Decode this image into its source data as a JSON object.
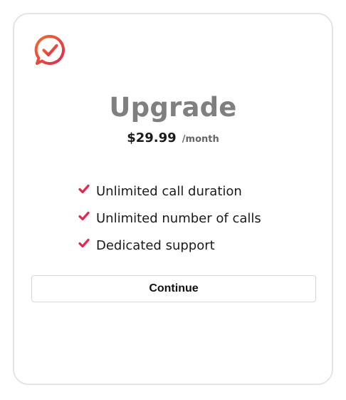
{
  "card": {
    "title": "Upgrade",
    "price": "$29.99",
    "period": "/month",
    "features": [
      {
        "label": "Unlimited call duration",
        "icon": "check-icon"
      },
      {
        "label": "Unlimited number of calls",
        "icon": "check-icon"
      },
      {
        "label": "Dedicated support",
        "icon": "check-icon"
      }
    ],
    "continue_label": "Continue",
    "logo_icon": "chat-bubble-check-icon"
  },
  "colors": {
    "title": "#7f7f7f",
    "check": "#e0294f",
    "logo_gradient_start": "#f2632c",
    "logo_gradient_end": "#e0294f"
  }
}
